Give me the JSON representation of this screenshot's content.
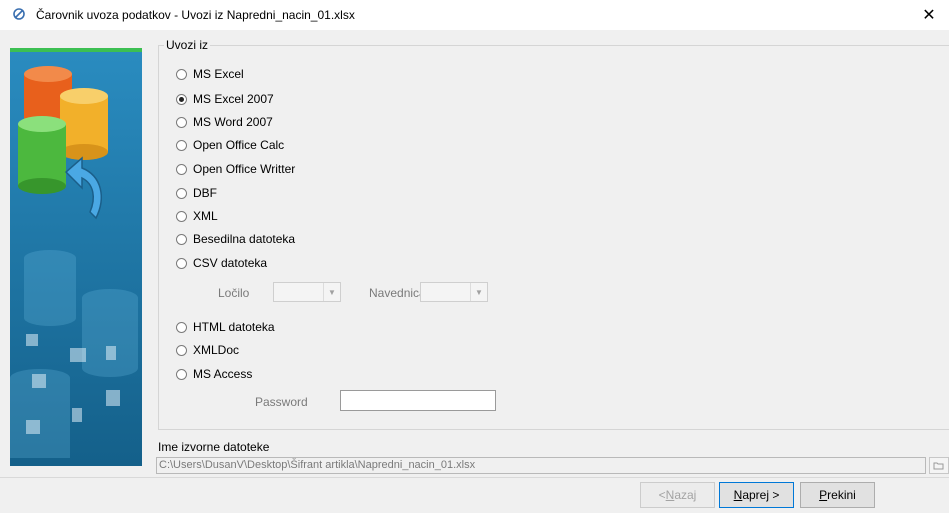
{
  "window": {
    "title": "Čarovnik uvoza podatkov - Uvozi iz Napredni_nacin_01.xlsx",
    "close_glyph": "✕"
  },
  "group": {
    "caption": "Uvozi iz",
    "options": [
      {
        "label": "MS Excel",
        "checked": false
      },
      {
        "label": "MS Excel 2007",
        "checked": true
      },
      {
        "label": "MS Word 2007",
        "checked": false
      },
      {
        "label": "Open Office Calc",
        "checked": false
      },
      {
        "label": "Open Office Writter",
        "checked": false
      },
      {
        "label": "DBF",
        "checked": false
      },
      {
        "label": "XML",
        "checked": false
      },
      {
        "label": "Besedilna datoteka",
        "checked": false
      },
      {
        "label": "CSV datoteka",
        "checked": false
      },
      {
        "label": "HTML datoteka",
        "checked": false
      },
      {
        "label": "XMLDoc",
        "checked": false
      },
      {
        "label": "MS Access",
        "checked": false
      }
    ],
    "csv": {
      "separator_label": "Ločilo",
      "quote_label": "Navednica"
    },
    "access": {
      "password_label": "Password",
      "password_value": ""
    }
  },
  "source": {
    "label": "Ime izvorne datoteke",
    "path": "C:\\Users\\DusanV\\Desktop\\Šifrant artikla\\Napredni_nacin_01.xlsx"
  },
  "buttons": {
    "back": {
      "prefix": "< ",
      "mnemonic": "N",
      "rest": "azaj"
    },
    "next": {
      "mnemonic": "N",
      "rest": "aprej >"
    },
    "cancel": {
      "mnemonic": "P",
      "rest": "rekini"
    }
  },
  "colors": {
    "side_panel": "#1b79a8",
    "side_accent": "#3cbf52",
    "default_button_border": "#0078d7"
  }
}
